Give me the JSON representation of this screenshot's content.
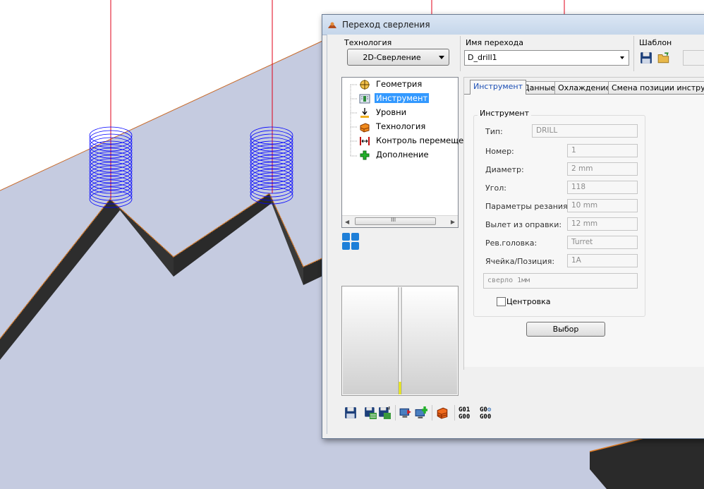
{
  "dialog": {
    "title": "Переход сверления",
    "technology": {
      "label": "Технология",
      "value": "2D-Сверление"
    },
    "step_name": {
      "label": "Имя перехода",
      "value": "D_drill1"
    },
    "template": {
      "label": "Шаблон"
    }
  },
  "tree": {
    "items": [
      {
        "label": "Геометрия",
        "icon": "geometry-icon"
      },
      {
        "label": "Инструмент",
        "icon": "tool-icon",
        "selected": true
      },
      {
        "label": "Уровни",
        "icon": "levels-icon"
      },
      {
        "label": "Технология",
        "icon": "technology-icon"
      },
      {
        "label": "Контроль перемещен",
        "icon": "motion-control-icon"
      },
      {
        "label": "Дополнение",
        "icon": "addition-icon"
      }
    ],
    "scroll_thumb_text": "III"
  },
  "tabs": [
    {
      "label": "Инструмент",
      "active": true
    },
    {
      "label": "Данные"
    },
    {
      "label": "Охлаждение"
    },
    {
      "label": "Смена позиции инструмента"
    }
  ],
  "tool": {
    "group_title": "Инструмент",
    "fields": [
      {
        "label": "Тип:",
        "value": "DRILL"
      },
      {
        "label": "Номер:",
        "value": "1"
      },
      {
        "label": "Диаметр:",
        "value": "2 mm"
      },
      {
        "label": "Угол:",
        "value": "118"
      },
      {
        "label": "Параметры резания:",
        "value": "10 mm"
      },
      {
        "label": "Вылет из оправки:",
        "value": "12 mm"
      },
      {
        "label": "Рев.головка:",
        "value": "Turret"
      },
      {
        "label": "Ячейка/Позиция:",
        "value": "1A"
      }
    ],
    "note": "сверло 1мм",
    "centering_label": "Центровка",
    "centering_checked": false,
    "select_button": "Выбор"
  },
  "bottom_toolbar": {
    "gcode_1": [
      "G01",
      "G00"
    ],
    "gcode_2": [
      "G0",
      "G00"
    ]
  },
  "colors": {
    "background": "#c5cbe0",
    "plane_edge": "#c86a2a",
    "toolpath": "#0000ff",
    "axis_line": "#e0001a",
    "part": "#2a2a2a",
    "selection": "#3399ff"
  }
}
